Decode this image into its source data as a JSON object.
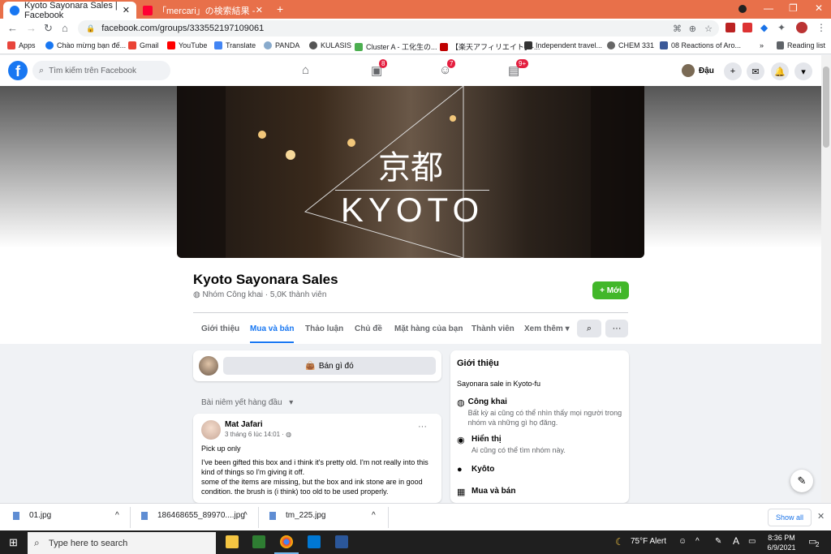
{
  "browser": {
    "tabs": [
      {
        "title": "Kyoto Sayonara Sales | Facebook",
        "active": true
      },
      {
        "title": "「mercari」の検索結果 - Yahoo!検",
        "active": false
      }
    ],
    "new_tab": "+",
    "url": "facebook.com/groups/333552197109061",
    "bookmarks": [
      "Apps",
      "Chào mừng bạn đế...",
      "Gmail",
      "YouTube",
      "Translate",
      "PANDA",
      "KULASIS",
      "Cluster A - 工化生の...",
      "【楽天アフィリエイト】-...",
      "Independent travel...",
      "CHEM 331",
      "08 Reactions of Aro..."
    ],
    "bookmarks_more": "»",
    "reading_list": "Reading list"
  },
  "facebook": {
    "logo": "f",
    "search_placeholder": "Tìm kiếm trên Facebook",
    "badges": {
      "watch": "8",
      "groups": "7",
      "gaming": "9+"
    },
    "profile_name": "Đậu",
    "colors": {
      "brand": "#1877f2",
      "badge": "#e41e3f",
      "new_button": "#42b72a"
    }
  },
  "group": {
    "cover_kanji": "京都",
    "cover_text": "KYOTO",
    "name": "Kyoto Sayonara Sales",
    "meta": "Nhóm Công khai · 5,0K thành viên",
    "new_button": "+ Mới",
    "tabs": [
      "Giới thiệu",
      "Mua và bán",
      "Thảo luận",
      "Chủ đề",
      "Mặt hàng của bạn",
      "Thành viên",
      "Xem thêm ▾"
    ],
    "active_tab": "Mua và bán",
    "more_button": "···"
  },
  "composer": {
    "sell_button": "Bán gì đó"
  },
  "pinned_label": "Bài niêm yết hàng đầu",
  "post": {
    "author": "Mat Jafari",
    "time": "3 tháng 6 lúc 14:01 · ",
    "title": "Pick up only",
    "body1": "I've been gifted this box and i think it's pretty old. I'm not really into this kind of things so I'm giving it off.",
    "body2": "some of the items are missing, but the box and ink stone are in good condition. the brush is (i think) too old to be used properly.",
    "menu": "···"
  },
  "intro": {
    "heading": "Giới thiệu",
    "description": "Sayonara sale in Kyoto-fu",
    "items": [
      {
        "title": "Công khai",
        "desc": "Bất kỳ ai cũng có thể nhìn thấy mọi người trong nhóm và những gì họ đăng."
      },
      {
        "title": "Hiển thị",
        "desc": "Ai cũng có thể tìm nhóm này."
      },
      {
        "title": "Kyôto",
        "desc": ""
      },
      {
        "title": "Mua và bán",
        "desc": ""
      }
    ]
  },
  "downloads": [
    {
      "name": "01.jpg"
    },
    {
      "name": "186468655_89970....jpg"
    },
    {
      "name": "tm_225.jpg"
    }
  ],
  "downloads_show_all": "Show all",
  "taskbar": {
    "search_placeholder": "Type here to search",
    "weather": "75°F Alert",
    "ime": "A",
    "time": "8:36 PM",
    "date": "6/9/2021",
    "notifications": "2"
  }
}
